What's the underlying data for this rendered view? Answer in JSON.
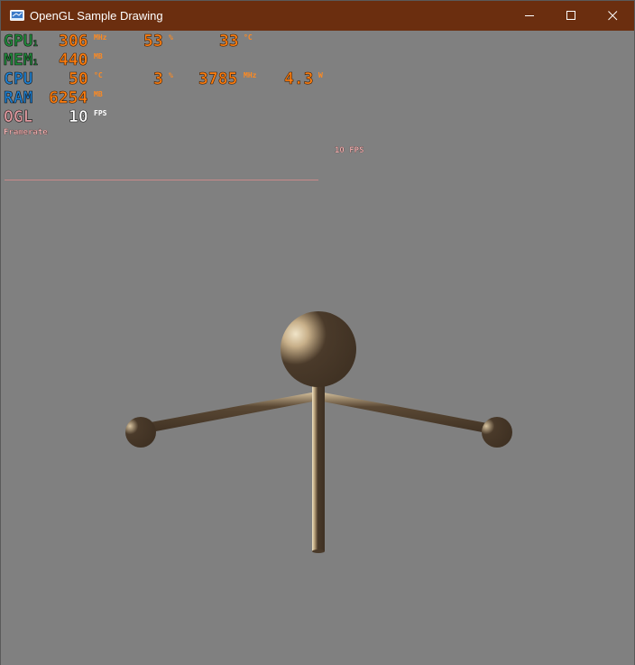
{
  "window": {
    "title": "OpenGL Sample Drawing",
    "titlebar_color": "#6b2e0f",
    "minimize_icon": "minimize-icon",
    "maximize_icon": "maximize-icon",
    "close_icon": "close-icon"
  },
  "overlay": {
    "gpu": {
      "label": "GPU",
      "sub": "1",
      "clock": "306",
      "clock_unit": "MHz",
      "usage": "53",
      "usage_unit": "%",
      "temp": "33",
      "temp_unit": "°C",
      "color": "#1f8a3a"
    },
    "mem": {
      "label": "MEM",
      "sub": "1",
      "value": "440",
      "unit": "MB",
      "color": "#1f8a3a"
    },
    "cpu": {
      "label": "CPU",
      "temp": "50",
      "temp_unit": "°C",
      "usage": "3",
      "usage_unit": "%",
      "clock": "3785",
      "clock_unit": "MHz",
      "power": "4.3",
      "power_unit": "W",
      "color": "#1e7fd0"
    },
    "ram": {
      "label": "RAM",
      "value": "6254",
      "unit": "MB",
      "color": "#1e7fd0"
    },
    "ogl": {
      "label": "OGL",
      "fps": "10",
      "fps_unit": "FPS",
      "color": "#e09aa0"
    },
    "framerate_label": "Framerate",
    "graph_fps": "10 FPS"
  },
  "scene": {
    "background": "#808080",
    "figure_color": "#4a3a2a",
    "highlight_color": "#e8d8b8"
  }
}
